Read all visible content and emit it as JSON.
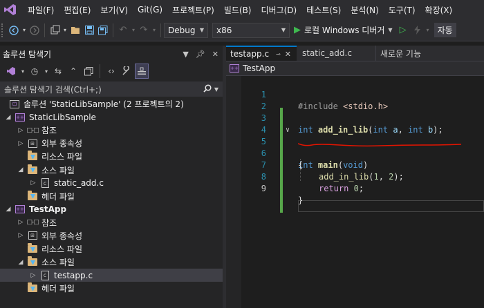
{
  "menu": {
    "items": [
      "파일(F)",
      "편집(E)",
      "보기(V)",
      "Git(G)",
      "프로젝트(P)",
      "빌드(B)",
      "디버그(D)",
      "테스트(S)",
      "분석(N)",
      "도구(T)",
      "확장(X)"
    ]
  },
  "toolbar": {
    "config": "Debug",
    "platform": "x86",
    "run_label": "로컬 Windows 디버거",
    "autohide_label": "자동"
  },
  "solution_explorer": {
    "title": "솔루션 탐색기",
    "search_placeholder": "솔루션 탐색기 검색(Ctrl+;)",
    "tree": [
      {
        "label": "솔루션 'StaticLibSample'  (2 프로젝트의 2)"
      },
      {
        "label": "StaticLibSample"
      },
      {
        "label": "참조"
      },
      {
        "label": "외부 종속성"
      },
      {
        "label": "리소스 파일"
      },
      {
        "label": "소스 파일"
      },
      {
        "label": "static_add.c"
      },
      {
        "label": "헤더 파일"
      },
      {
        "label": "TestApp"
      },
      {
        "label": "참조"
      },
      {
        "label": "외부 종속성"
      },
      {
        "label": "리소스 파일"
      },
      {
        "label": "소스 파일"
      },
      {
        "label": "testapp.c"
      },
      {
        "label": "헤더 파일"
      }
    ]
  },
  "editor": {
    "tabs": [
      {
        "label": "testapp.c"
      },
      {
        "label": "static_add.c"
      },
      {
        "label": "새로운 기능"
      }
    ],
    "nav_project": "TestApp",
    "line_numbers": [
      "1",
      "2",
      "3",
      "4",
      "5",
      "6",
      "7",
      "8",
      "9"
    ],
    "code": {
      "l1_directive": "#include",
      "l1_header": "<stdio.h>",
      "l3_type": "int",
      "l3_name": "add_in_lib",
      "l3_open": "(",
      "l3_t1": "int",
      "l3_p1": "a",
      "l3_comma": ", ",
      "l3_t2": "int",
      "l3_p2": "b",
      "l3_close": ");",
      "l5_type": "int",
      "l5_name": "main",
      "l5_open": "(",
      "l5_void": "void",
      "l5_close": ")",
      "l6": "{",
      "l7_name": "add_in_lib",
      "l7_open": "(",
      "l7_n1": "1",
      "l7_comma": ", ",
      "l7_n2": "2",
      "l7_close": ");",
      "l8_kw": "return",
      "l8_num": "0",
      "l8_semi": ";",
      "l9": "}"
    }
  },
  "colors": {
    "accent": "#007acc",
    "change_bar": "#57a64a",
    "error_squiggle": "#e51400"
  }
}
